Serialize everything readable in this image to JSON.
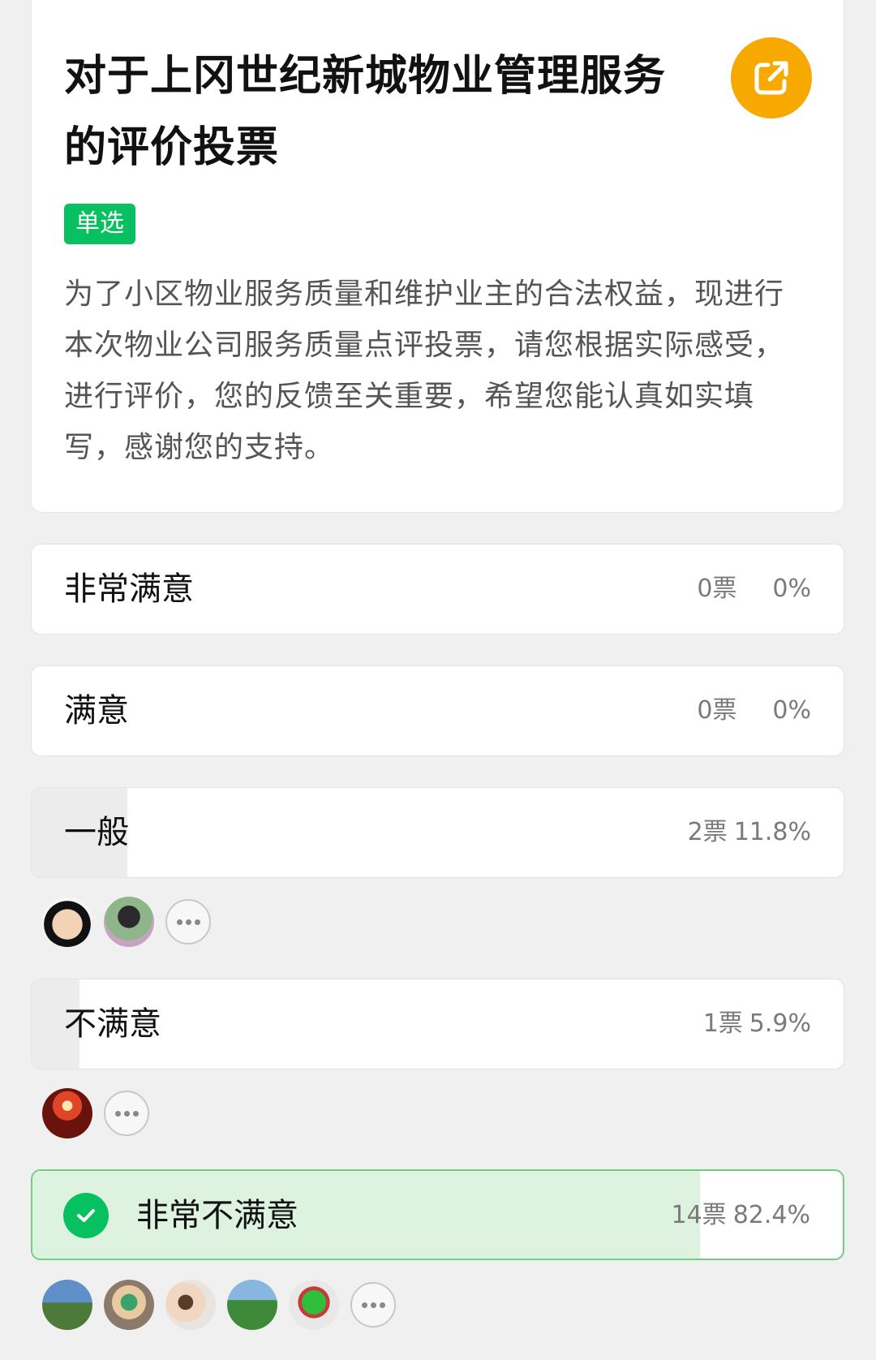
{
  "poll": {
    "title": "对于上冈世纪新城物业管理服务的评价投票",
    "type_tag": "单选",
    "description": "为了小区物业服务质量和维护业主的合法权益，现进行本次物业公司服务质量点评投票，请您根据实际感受，进行评价，您的反馈至关重要，希望您能认真如实填写，感谢您的支持。",
    "share_icon": "share-icon"
  },
  "options": [
    {
      "label": "非常满意",
      "votes": "0票",
      "percent": "0%",
      "fraction": 0
    },
    {
      "label": "满意",
      "votes": "0票",
      "percent": "0%",
      "fraction": 0
    },
    {
      "label": "一般",
      "votes": "2票",
      "percent": "11.8%",
      "fraction": 0.118
    },
    {
      "label": "不满意",
      "votes": "1票",
      "percent": "5.9%",
      "fraction": 0.059
    },
    {
      "label": "非常不满意",
      "votes": "14票",
      "percent": "82.4%",
      "fraction": 0.824,
      "selected": true
    }
  ],
  "colors": {
    "accent_green": "#07c160",
    "share_orange": "#f7a900",
    "selected_fill": "#ddf3df",
    "result_fill": "#ececec"
  }
}
